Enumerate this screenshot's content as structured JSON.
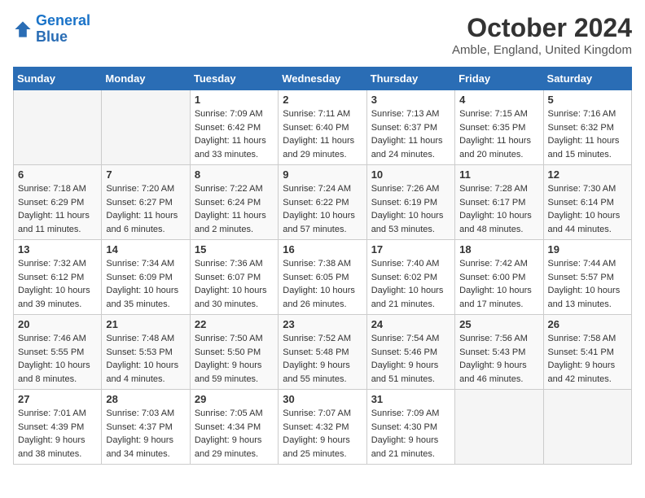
{
  "header": {
    "logo_line1": "General",
    "logo_line2": "Blue",
    "month_title": "October 2024",
    "location": "Amble, England, United Kingdom"
  },
  "days_of_week": [
    "Sunday",
    "Monday",
    "Tuesday",
    "Wednesday",
    "Thursday",
    "Friday",
    "Saturday"
  ],
  "weeks": [
    [
      {
        "num": "",
        "info": ""
      },
      {
        "num": "",
        "info": ""
      },
      {
        "num": "1",
        "info": "Sunrise: 7:09 AM\nSunset: 6:42 PM\nDaylight: 11 hours and 33 minutes."
      },
      {
        "num": "2",
        "info": "Sunrise: 7:11 AM\nSunset: 6:40 PM\nDaylight: 11 hours and 29 minutes."
      },
      {
        "num": "3",
        "info": "Sunrise: 7:13 AM\nSunset: 6:37 PM\nDaylight: 11 hours and 24 minutes."
      },
      {
        "num": "4",
        "info": "Sunrise: 7:15 AM\nSunset: 6:35 PM\nDaylight: 11 hours and 20 minutes."
      },
      {
        "num": "5",
        "info": "Sunrise: 7:16 AM\nSunset: 6:32 PM\nDaylight: 11 hours and 15 minutes."
      }
    ],
    [
      {
        "num": "6",
        "info": "Sunrise: 7:18 AM\nSunset: 6:29 PM\nDaylight: 11 hours and 11 minutes."
      },
      {
        "num": "7",
        "info": "Sunrise: 7:20 AM\nSunset: 6:27 PM\nDaylight: 11 hours and 6 minutes."
      },
      {
        "num": "8",
        "info": "Sunrise: 7:22 AM\nSunset: 6:24 PM\nDaylight: 11 hours and 2 minutes."
      },
      {
        "num": "9",
        "info": "Sunrise: 7:24 AM\nSunset: 6:22 PM\nDaylight: 10 hours and 57 minutes."
      },
      {
        "num": "10",
        "info": "Sunrise: 7:26 AM\nSunset: 6:19 PM\nDaylight: 10 hours and 53 minutes."
      },
      {
        "num": "11",
        "info": "Sunrise: 7:28 AM\nSunset: 6:17 PM\nDaylight: 10 hours and 48 minutes."
      },
      {
        "num": "12",
        "info": "Sunrise: 7:30 AM\nSunset: 6:14 PM\nDaylight: 10 hours and 44 minutes."
      }
    ],
    [
      {
        "num": "13",
        "info": "Sunrise: 7:32 AM\nSunset: 6:12 PM\nDaylight: 10 hours and 39 minutes."
      },
      {
        "num": "14",
        "info": "Sunrise: 7:34 AM\nSunset: 6:09 PM\nDaylight: 10 hours and 35 minutes."
      },
      {
        "num": "15",
        "info": "Sunrise: 7:36 AM\nSunset: 6:07 PM\nDaylight: 10 hours and 30 minutes."
      },
      {
        "num": "16",
        "info": "Sunrise: 7:38 AM\nSunset: 6:05 PM\nDaylight: 10 hours and 26 minutes."
      },
      {
        "num": "17",
        "info": "Sunrise: 7:40 AM\nSunset: 6:02 PM\nDaylight: 10 hours and 21 minutes."
      },
      {
        "num": "18",
        "info": "Sunrise: 7:42 AM\nSunset: 6:00 PM\nDaylight: 10 hours and 17 minutes."
      },
      {
        "num": "19",
        "info": "Sunrise: 7:44 AM\nSunset: 5:57 PM\nDaylight: 10 hours and 13 minutes."
      }
    ],
    [
      {
        "num": "20",
        "info": "Sunrise: 7:46 AM\nSunset: 5:55 PM\nDaylight: 10 hours and 8 minutes."
      },
      {
        "num": "21",
        "info": "Sunrise: 7:48 AM\nSunset: 5:53 PM\nDaylight: 10 hours and 4 minutes."
      },
      {
        "num": "22",
        "info": "Sunrise: 7:50 AM\nSunset: 5:50 PM\nDaylight: 9 hours and 59 minutes."
      },
      {
        "num": "23",
        "info": "Sunrise: 7:52 AM\nSunset: 5:48 PM\nDaylight: 9 hours and 55 minutes."
      },
      {
        "num": "24",
        "info": "Sunrise: 7:54 AM\nSunset: 5:46 PM\nDaylight: 9 hours and 51 minutes."
      },
      {
        "num": "25",
        "info": "Sunrise: 7:56 AM\nSunset: 5:43 PM\nDaylight: 9 hours and 46 minutes."
      },
      {
        "num": "26",
        "info": "Sunrise: 7:58 AM\nSunset: 5:41 PM\nDaylight: 9 hours and 42 minutes."
      }
    ],
    [
      {
        "num": "27",
        "info": "Sunrise: 7:01 AM\nSunset: 4:39 PM\nDaylight: 9 hours and 38 minutes."
      },
      {
        "num": "28",
        "info": "Sunrise: 7:03 AM\nSunset: 4:37 PM\nDaylight: 9 hours and 34 minutes."
      },
      {
        "num": "29",
        "info": "Sunrise: 7:05 AM\nSunset: 4:34 PM\nDaylight: 9 hours and 29 minutes."
      },
      {
        "num": "30",
        "info": "Sunrise: 7:07 AM\nSunset: 4:32 PM\nDaylight: 9 hours and 25 minutes."
      },
      {
        "num": "31",
        "info": "Sunrise: 7:09 AM\nSunset: 4:30 PM\nDaylight: 9 hours and 21 minutes."
      },
      {
        "num": "",
        "info": ""
      },
      {
        "num": "",
        "info": ""
      }
    ]
  ]
}
